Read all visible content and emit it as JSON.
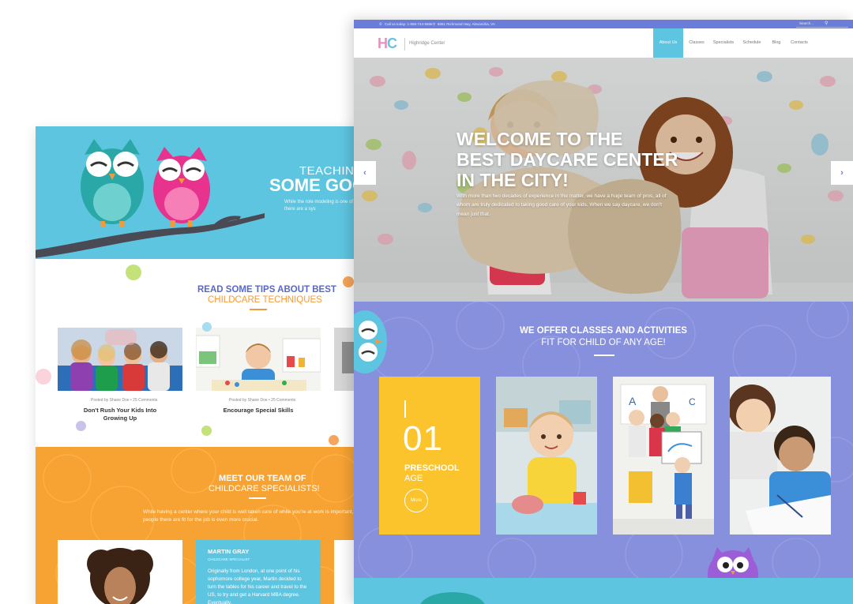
{
  "back_page": {
    "hero": {
      "line1": "TEACHING",
      "line2": "SOME GOO",
      "paragraph": "While the role modeling is one of th behave in the society, there are a sys"
    },
    "tips": {
      "heading_bold": "READ SOME TIPS ABOUT BEST",
      "heading_light": "CHILDCARE TECHNIQUES",
      "posts": [
        {
          "meta": "Posted by Shane Doe  •  25 Comments",
          "title": "Don't Rush Your Kids Into Growing Up"
        },
        {
          "meta": "Posted by Shane Doe  •  25 Comments",
          "title": "Encourage Special Skills"
        }
      ]
    },
    "team": {
      "heading_bold": "MEET OUR TEAM OF",
      "heading_light": "CHILDCARE SPECIALISTS!",
      "paragraph": "While having a center where your child is well taken care of while you're at work is important, knowin people there are fit for the job is even more crucial.",
      "member": {
        "name": "MARTIN GRAY",
        "role": "CHILDCARE SPECIALIST",
        "bio": "Originally from London, at one point of his sophomore college year, Martin decided to turn the tables for his career and travel to the US, to try and get a Harvard MBA degree. Eventually,"
      }
    }
  },
  "front_page": {
    "topbar": {
      "phone": "Call us today: 1-555-744-5566",
      "address": "8061 Richmond Hwy, Alexandria, VA",
      "search_placeholder": "Search..."
    },
    "logo": {
      "letter_h": "H",
      "letter_c": "C",
      "name": "Highridge Center"
    },
    "nav": [
      "About Us",
      "Classes",
      "Specialists",
      "Schedule",
      "Blog",
      "Contacts"
    ],
    "nav_active": "About Us",
    "hero": {
      "heading_line1": "WELCOME TO THE",
      "heading_line2": "BEST DAYCARE CENTER",
      "heading_line3": "IN THE CITY!",
      "paragraph": "With more than two decades of experience in the matter, we have a huge team of pros, all of whom are truly dedicated to taking good care of your kids. When we say daycare, we don't mean just that."
    },
    "classes": {
      "heading_bold": "WE OFFER CLASSES AND ACTIVITIES",
      "heading_light": "FIT FOR CHILD OF ANY AGE!",
      "feature": {
        "number": "01",
        "label": "PRESCHOOL",
        "sublabel": "AGE",
        "button": "More"
      }
    }
  },
  "colors": {
    "primary_blue": "#6a7dd8",
    "classes_bg": "#8790dc",
    "teal": "#5ec5e1",
    "orange": "#f7a334",
    "yellow": "#fbc42c",
    "pink": "#f08bc0"
  }
}
